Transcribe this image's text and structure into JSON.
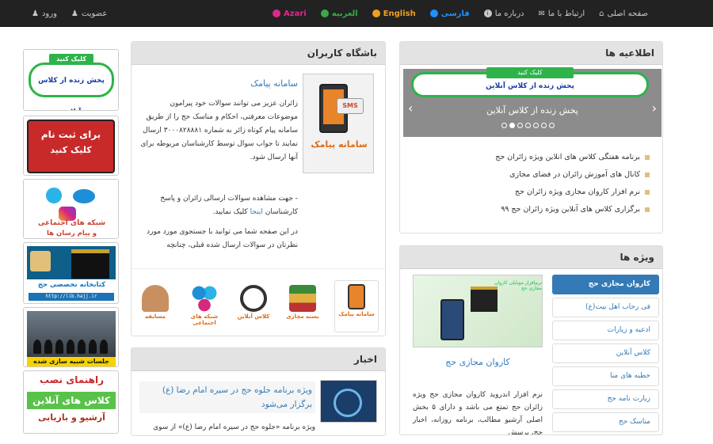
{
  "nav": {
    "right": [
      {
        "label": "صفحه اصلی",
        "icon": "home-icon",
        "glyph": "⌂"
      },
      {
        "label": "ارتباط با ما",
        "icon": "envelope-icon",
        "glyph": "✉"
      },
      {
        "label": "درباره ما",
        "icon": "info-icon",
        "glyph": "i"
      },
      {
        "label": "فارسی",
        "icon": "globe-icon",
        "glyph": "◉",
        "color": "#1e90ff"
      },
      {
        "label": "English",
        "icon": "globe-icon",
        "glyph": "◉",
        "color": "#f0a020"
      },
      {
        "label": "العربيه",
        "icon": "globe-icon",
        "glyph": "◉",
        "color": "#3aa84a"
      },
      {
        "label": "Azari",
        "icon": "globe-icon",
        "glyph": "◉",
        "color": "#e0288a"
      }
    ],
    "left": [
      {
        "label": "ورود",
        "icon": "user-icon",
        "glyph": "👤"
      },
      {
        "label": "عضویت",
        "icon": "user-icon",
        "glyph": "👤"
      }
    ]
  },
  "announcements": {
    "title": "اطلاعیه ها",
    "banner_tag": "کلیک کنید",
    "banner_text": "پخش زنده از کلاس آنلاین",
    "caption": "پخش زنده از کلاس آنلاین",
    "items": [
      "برنامه هفتگی کلاس های انلاین ویژه زائران حج",
      "کانال های آموزش زائران در فضای مجازی",
      "نرم افزار کاروان مجازی ویژه زائران حج",
      "برگزاری کلاس های آنلاین ویژه زائران حج ۹۹"
    ]
  },
  "special": {
    "title": "ویژه ها",
    "tabs": [
      "کاروان مجازی حج",
      "فی رحاب اهل بیت(ع)",
      "ادعیه و زیارات",
      "کلاس آنلاین",
      "خطبه های منا",
      "زیارت نامه حج",
      "مناسک حج"
    ],
    "img_title": "نرم‌افزار موبایلی کاروان مجازی حج",
    "item_title": "کاروان مجازی حج",
    "item_desc": "نرم افزار اندروید کاروان مجازی حج ویژه زائران حج تمتع می باشد و دارای ۵ بخش اصلی آرشیو مطالب، برنامه روزانه، اخبار حج، پرسش"
  },
  "club": {
    "title": "باشگاه کاربران",
    "sms_bubble": "SMS",
    "sms_caption": "سامانه پیامک",
    "item_title": "سامانه پیامک",
    "p1": "زائران عزیز می توانند سوالات خود پیرامون موضوعات معرفتی، احکام و مناسک حج را از طریق سامانه پیام کوتاه زائر به شماره ۳۰۰۰۸۲۸۸۸۱ ارسال نمایند تا جواب سوال توسط کارشناسان مربوطه برای آنها ارسال شود.",
    "p2_pre": "- جهت مشاهده سوالات ارسالی زائران و پاسخ کارشناسان ",
    "p2_link": "اینجا",
    "p2_post": " کلیک نمایید.",
    "p3": "در این صفحه شما می توانید با جستجوی مورد مورد نظرتان در سوالات ارسال شده قبلی، چنانچه",
    "thumbs": [
      "سامانه پیامک",
      "بسته مجازی",
      "کلاس آنلاین",
      "شبکه های اجتماعی",
      "مسابقه"
    ]
  },
  "news": {
    "title": "اخبار",
    "item_title": "ویژه برنامه جلوه حج در سیره امام رضا (ع) برگزار می‌شود",
    "item_body": "ویژه برنامه «جلوه حج در سیره امام رضا (ع)» از سوی"
  },
  "banners": {
    "b1_tag": "کلیک کنید",
    "b1_text": "پخش زنده از کلاس آنلاین",
    "b2_a": "برای ثبت نام",
    "b2_b": "کلیک کنید",
    "b3_t1": "شبکه های اجتماعی",
    "b3_t2": "و پیام رسان ها",
    "b4_t": "کتابخانه تخصصی حج",
    "b4_url": "http://lib.hajj.ir",
    "b5_cap": "جلسات شبیه سازی شده کاروانی",
    "b6_t1": "راهنمای نصب",
    "b6_t2": "کلاس های آنلاین",
    "b6_t3": "آرشیو و بازیابی"
  }
}
